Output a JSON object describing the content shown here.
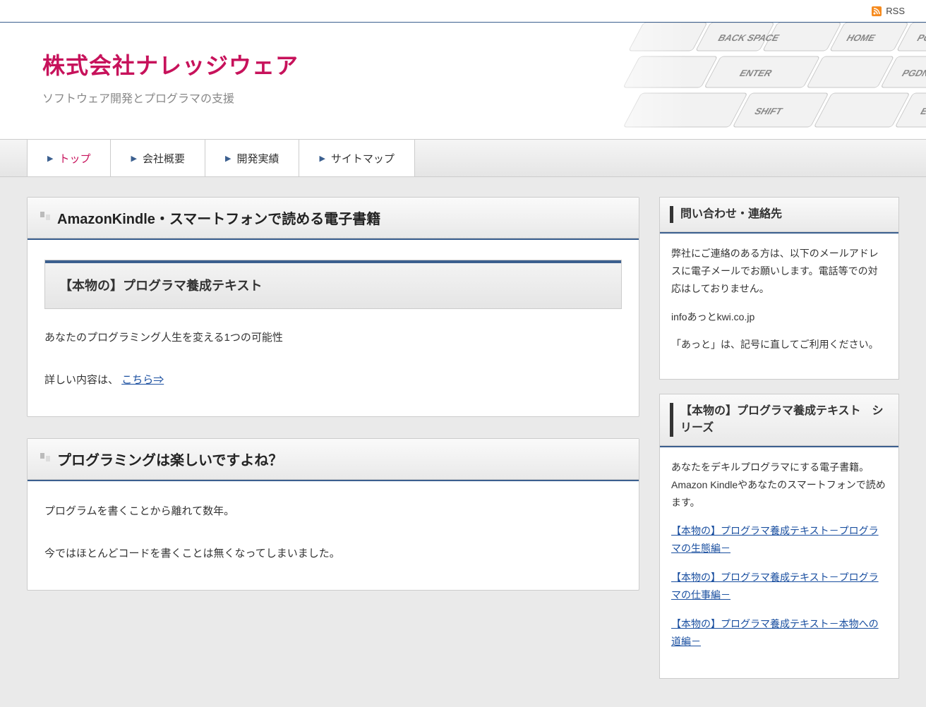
{
  "topbar": {
    "rss": "RSS"
  },
  "header": {
    "title": "株式会社ナレッジウェア",
    "subtitle": "ソフトウェア開発とプログラマの支援"
  },
  "nav": {
    "items": [
      {
        "label": "トップ",
        "active": true
      },
      {
        "label": "会社概要",
        "active": false
      },
      {
        "label": "開発実績",
        "active": false
      },
      {
        "label": "サイトマップ",
        "active": false
      }
    ]
  },
  "main": {
    "sections": [
      {
        "heading": "AmazonKindle・スマートフォンで読める電子書籍",
        "sub_heading": "【本物の】プログラマ養成テキスト",
        "p1": "あなたのプログラミング人生を変える1つの可能性",
        "p2_prefix": "詳しい内容は、",
        "p2_link": "こちら⇒"
      },
      {
        "heading": "プログラミングは楽しいですよね？",
        "p1": "プログラムを書くことから離れて数年。",
        "p2": "今ではほとんどコードを書くことは無くなってしまいました。"
      }
    ]
  },
  "sidebar": {
    "contact": {
      "heading": "問い合わせ・連絡先",
      "p1": "弊社にご連絡のある方は、以下のメールアドレスに電子メールでお願いします。電話等での対応はしておりません。",
      "email": "infoあっとkwi.co.jp",
      "p2": "「あっと」は、記号に直してご利用ください。"
    },
    "series": {
      "heading": "【本物の】プログラマ養成テキスト　シリーズ",
      "intro": "あなたをデキルプログラマにする電子書籍。\nAmazon Kindleやあなたのスマートフォンで読めます。",
      "links": [
        "【本物の】プログラマ養成テキスト－プログラマの生態編－",
        "【本物の】プログラマ養成テキスト－プログラマの仕事編－",
        "【本物の】プログラマ養成テキスト－本物への道編－"
      ]
    }
  }
}
